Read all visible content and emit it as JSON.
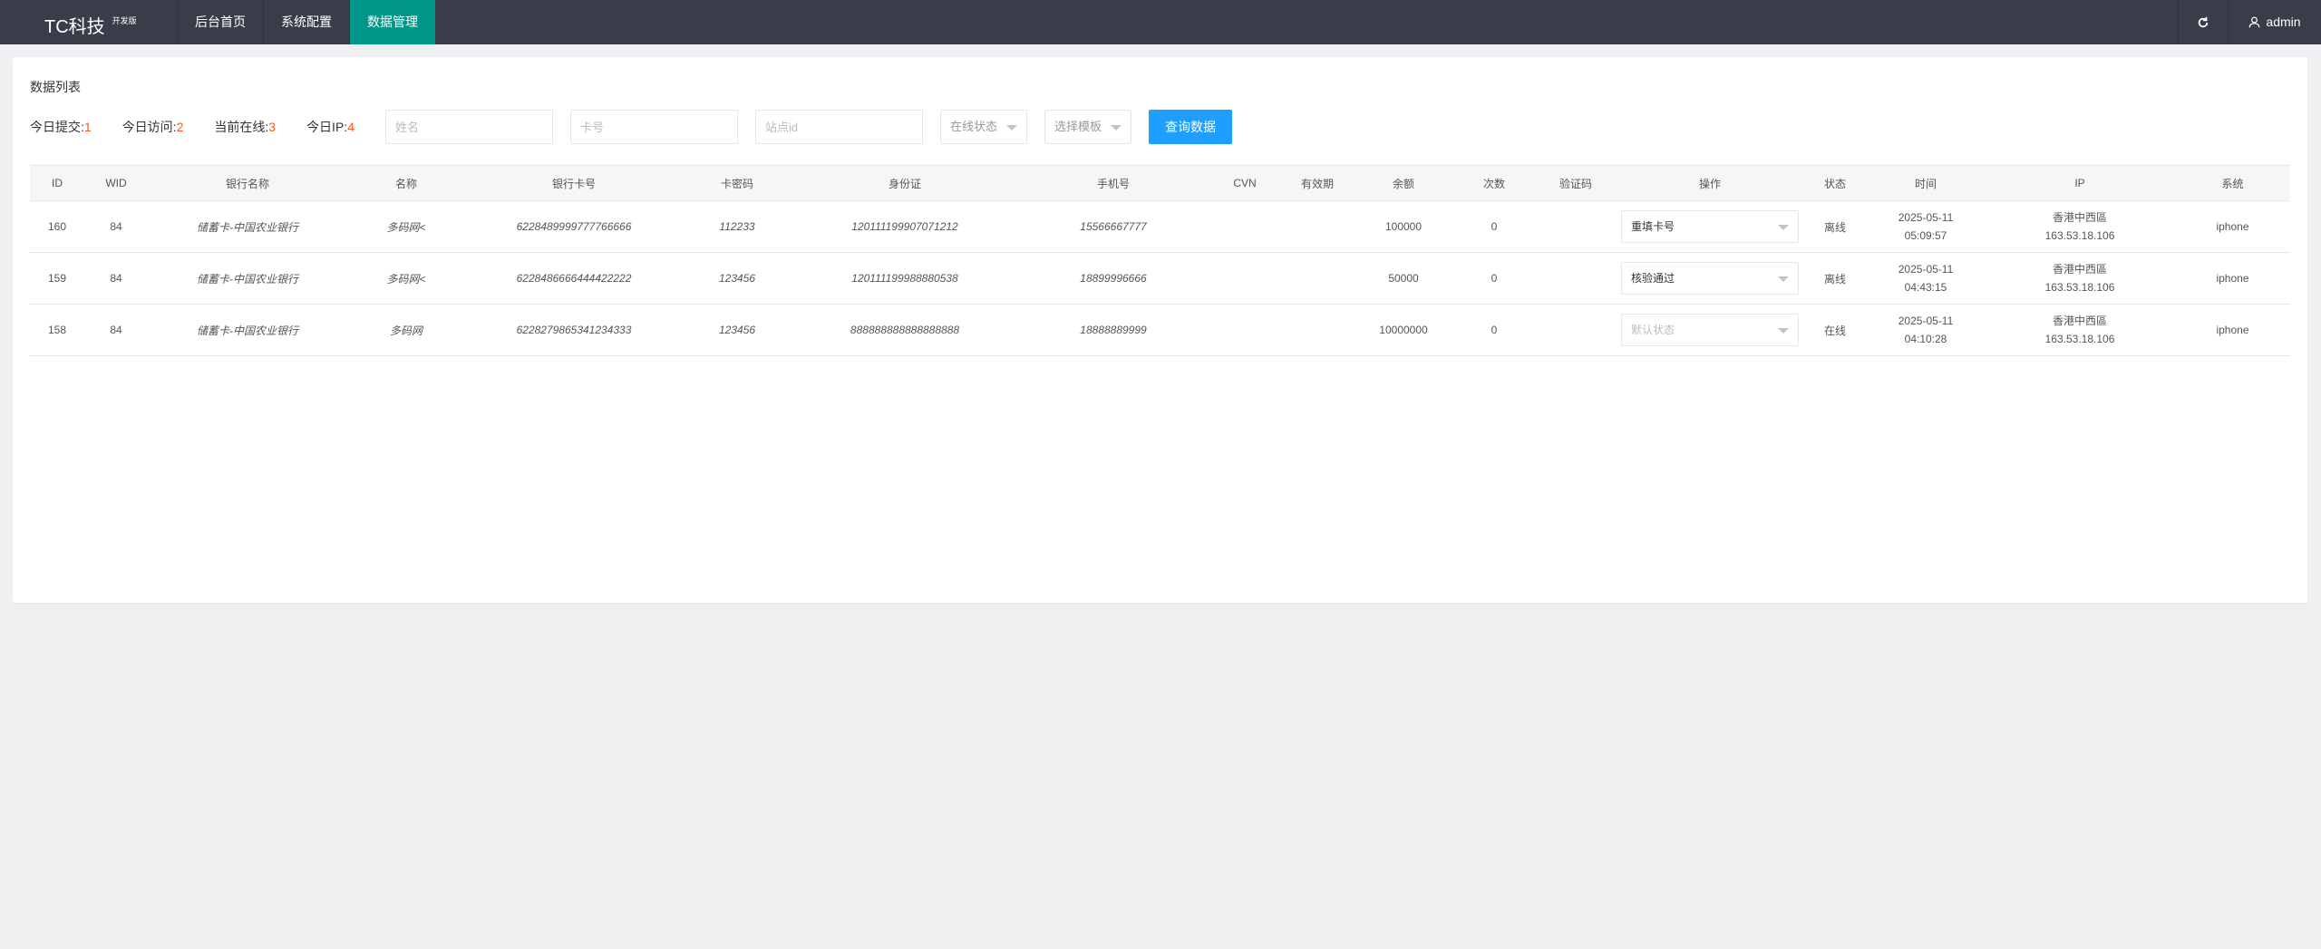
{
  "header": {
    "logo": "TC科技",
    "logo_badge": "开发版",
    "nav": [
      "后台首页",
      "系统配置",
      "数据管理"
    ],
    "active_nav": 2,
    "refresh_icon": "refresh-icon",
    "user_icon": "user-icon",
    "user_name": "admin"
  },
  "card": {
    "title": "数据列表",
    "stats": [
      {
        "label": "今日提交:",
        "value": "1"
      },
      {
        "label": "今日访问:",
        "value": "2"
      },
      {
        "label": "当前在线:",
        "value": "3"
      },
      {
        "label": "今日IP:",
        "value": "4"
      }
    ],
    "inputs": {
      "name_placeholder": "姓名",
      "card_placeholder": "卡号",
      "site_placeholder": "站点id"
    },
    "selects": {
      "online_status": "在线状态",
      "template": "选择模板"
    },
    "query_button": "查询数据"
  },
  "table": {
    "headers": [
      "ID",
      "WID",
      "银行名称",
      "名称",
      "银行卡号",
      "卡密码",
      "身份证",
      "手机号",
      "CVN",
      "有效期",
      "余额",
      "次数",
      "验证码",
      "操作",
      "状态",
      "时间",
      "IP",
      "系统"
    ],
    "rows": [
      {
        "id": "160",
        "wid": "84",
        "bank": "储蓄卡-中国农业银行",
        "name": "多码网<",
        "card_no": "6228489999777766666",
        "card_pwd": "112233",
        "id_card": "120111199907071212",
        "phone": "15566667777",
        "cvn": "",
        "expiry": "",
        "balance": "100000",
        "count": "0",
        "code": "",
        "operation": "重填卡号",
        "op_placeholder": false,
        "status": "离线",
        "date": "2025-05-11",
        "time": "05:09:57",
        "ip_region": "香港中西區",
        "ip": "163.53.18.106",
        "system": "iphone"
      },
      {
        "id": "159",
        "wid": "84",
        "bank": "储蓄卡-中国农业银行",
        "name": "多码网<",
        "card_no": "6228486666444422222",
        "card_pwd": "123456",
        "id_card": "120111199988880538",
        "phone": "18899996666",
        "cvn": "",
        "expiry": "",
        "balance": "50000",
        "count": "0",
        "code": "",
        "operation": "核验通过",
        "op_placeholder": false,
        "status": "离线",
        "date": "2025-05-11",
        "time": "04:43:15",
        "ip_region": "香港中西區",
        "ip": "163.53.18.106",
        "system": "iphone"
      },
      {
        "id": "158",
        "wid": "84",
        "bank": "储蓄卡-中国农业银行",
        "name": "多码网",
        "card_no": "6228279865341234333",
        "card_pwd": "123456",
        "id_card": "888888888888888888",
        "phone": "18888889999",
        "cvn": "",
        "expiry": "",
        "balance": "10000000",
        "count": "0",
        "code": "",
        "operation": "默认状态",
        "op_placeholder": true,
        "status": "在线",
        "date": "2025-05-11",
        "time": "04:10:28",
        "ip_region": "香港中西區",
        "ip": "163.53.18.106",
        "system": "iphone"
      }
    ]
  }
}
